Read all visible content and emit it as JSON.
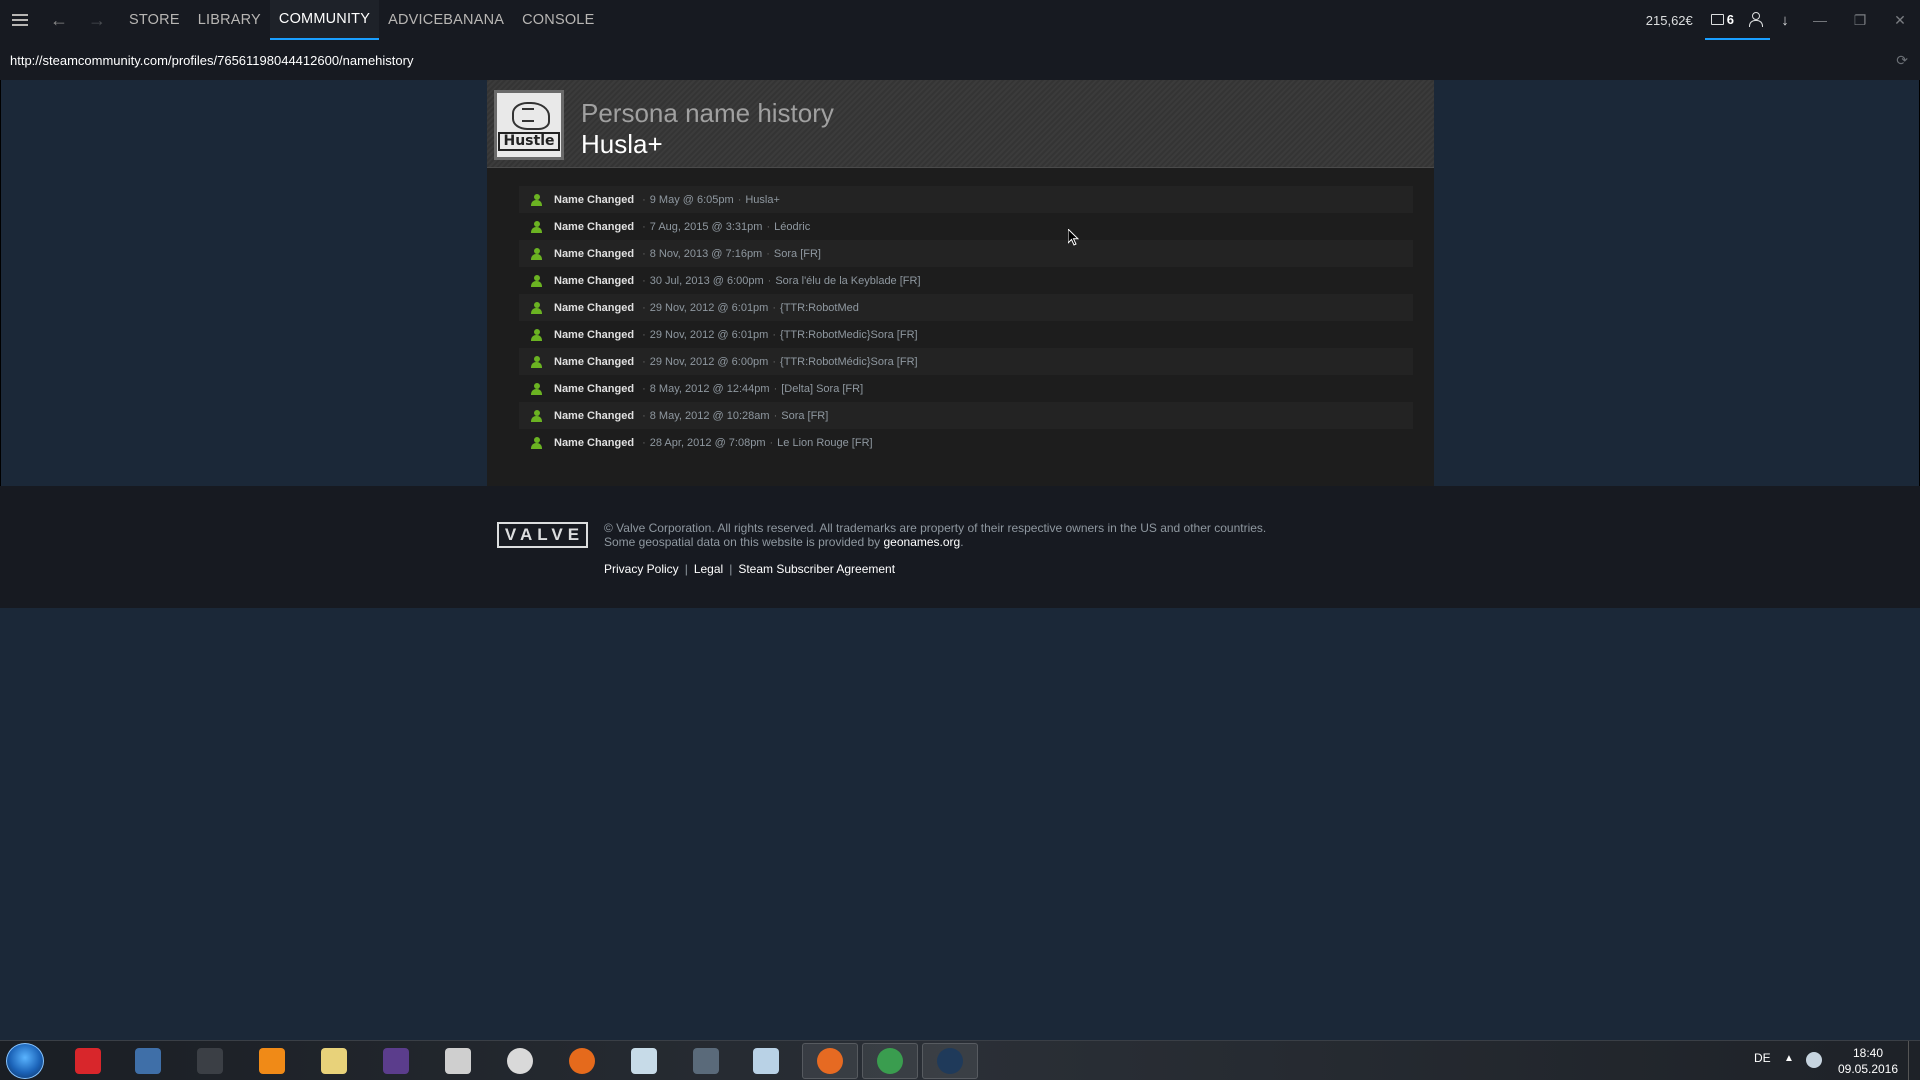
{
  "topbar": {
    "nav": [
      {
        "label": "STORE",
        "active": false
      },
      {
        "label": "LIBRARY",
        "active": false
      },
      {
        "label": "COMMUNITY",
        "active": true
      },
      {
        "label": "ADVICEBANANA",
        "active": false
      },
      {
        "label": "CONSOLE",
        "active": false
      }
    ],
    "wallet": "215,62€",
    "notifications_count": "6"
  },
  "urlbar": {
    "url": "http://steamcommunity.com/profiles/76561198044412600/namehistory"
  },
  "profile": {
    "avatar_text": "Hustle",
    "page_title": "Persona name history",
    "current_name": "Husla+"
  },
  "history": [
    {
      "label": "Name Changed",
      "date": "9 May @ 6:05pm",
      "name": "Husla+"
    },
    {
      "label": "Name Changed",
      "date": "7 Aug, 2015 @ 3:31pm",
      "name": "Léodric"
    },
    {
      "label": "Name Changed",
      "date": "8 Nov, 2013 @ 7:16pm",
      "name": "Sora [FR]"
    },
    {
      "label": "Name Changed",
      "date": "30 Jul, 2013 @ 6:00pm",
      "name": "Sora l'élu de la Keyblade [FR]"
    },
    {
      "label": "Name Changed",
      "date": "29 Nov, 2012 @ 6:01pm",
      "name": "{TTR:RobotMed"
    },
    {
      "label": "Name Changed",
      "date": "29 Nov, 2012 @ 6:01pm",
      "name": "{TTR:RobotMedic}Sora [FR]"
    },
    {
      "label": "Name Changed",
      "date": "29 Nov, 2012 @ 6:00pm",
      "name": "{TTR:RobotMédic}Sora [FR]"
    },
    {
      "label": "Name Changed",
      "date": "8 May, 2012 @ 12:44pm",
      "name": "[Delta] Sora [FR]"
    },
    {
      "label": "Name Changed",
      "date": "8 May, 2012 @ 10:28am",
      "name": "Sora [FR]"
    },
    {
      "label": "Name Changed",
      "date": "28 Apr, 2012 @ 7:08pm",
      "name": "Le Lion Rouge [FR]"
    }
  ],
  "history_separator": "·",
  "footer": {
    "logo_text": "VALVE",
    "legal_line1": "© Valve Corporation. All rights reserved. All trademarks are property of their respective owners in the US and other countries.",
    "legal_line2_prefix": "Some geospatial data on this website is provided by ",
    "legal_line2_link": "geonames.org",
    "legal_line2_suffix": ".",
    "links": [
      "Privacy Policy",
      "Legal",
      "Steam Subscriber Agreement"
    ],
    "link_separator": "|"
  },
  "taskbar": {
    "language": "DE",
    "time": "18:40",
    "date": "09.05.2016",
    "icons": [
      {
        "name": "red-star-app-icon",
        "color": "#d8262b"
      },
      {
        "name": "thunderbird-icon",
        "color": "#3f6fa8"
      },
      {
        "name": "terminal-icon",
        "color": "#3b3f45"
      },
      {
        "name": "vlc-icon",
        "color": "#f08a17"
      },
      {
        "name": "notepad-icon",
        "color": "#e8d27a"
      },
      {
        "name": "tex-editor-icon",
        "color": "#5b3d8c"
      },
      {
        "name": "qr-app-icon",
        "color": "#cfcfcf"
      },
      {
        "name": "mega-icon",
        "color": "#d9d9d9"
      },
      {
        "name": "sync-app-icon",
        "color": "#e56a1c"
      },
      {
        "name": "calculator-icon",
        "color": "#c7dbe8"
      },
      {
        "name": "disk-utility-icon",
        "color": "#5a6a7a"
      },
      {
        "name": "paper-app-icon",
        "color": "#b9d2e6"
      },
      {
        "name": "firefox-icon",
        "color": "#e66a22"
      },
      {
        "name": "chrome-icon",
        "color": "#3a9d4f"
      },
      {
        "name": "steam-icon",
        "color": "#1f3a5a"
      }
    ]
  }
}
